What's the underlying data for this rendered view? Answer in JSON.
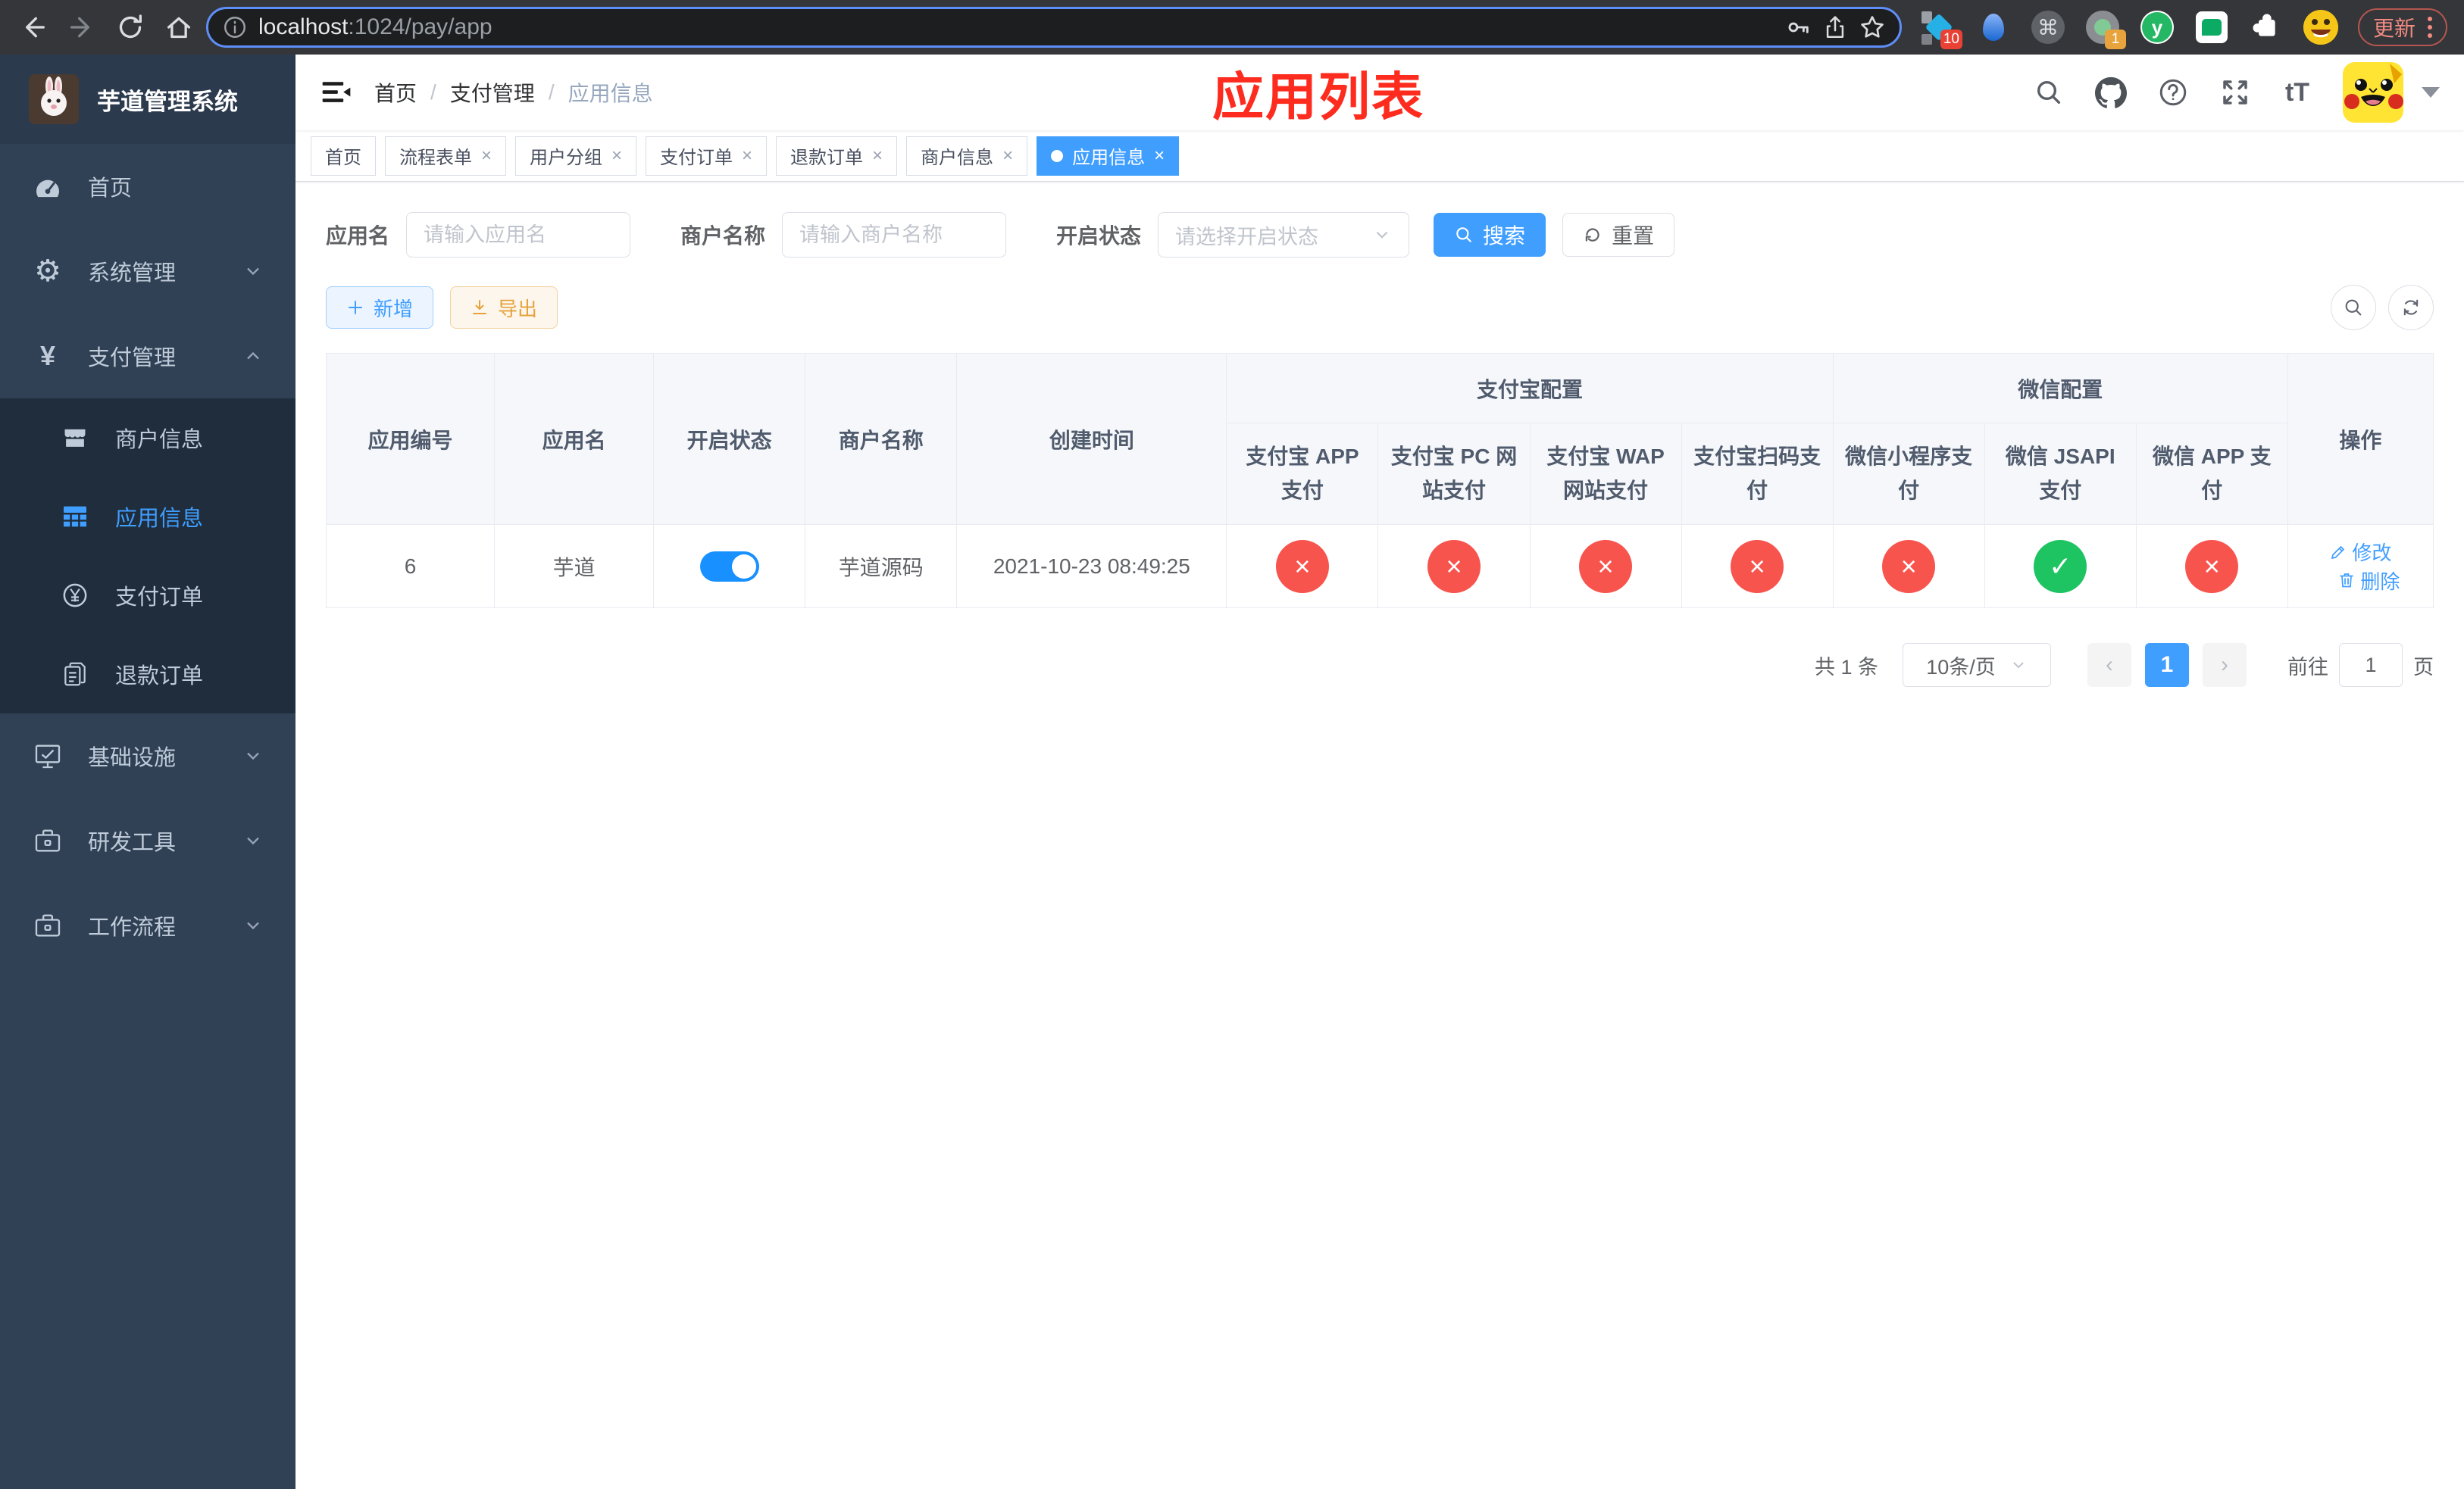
{
  "browser": {
    "url": {
      "host": "localhost",
      "path": ":1024/pay/app"
    },
    "update_label": "更新",
    "badges": {
      "diamond": "10",
      "profile": "1"
    },
    "yuque_letter": "y"
  },
  "sidebar": {
    "logo_title": "芋道管理系统",
    "home": "首页",
    "system": "系统管理",
    "payment": "支付管理",
    "sub_merchant": "商户信息",
    "sub_app": "应用信息",
    "sub_pay_order": "支付订单",
    "sub_refund_order": "退款订单",
    "infra": "基础设施",
    "dev_tools": "研发工具",
    "workflow": "工作流程",
    "payment_icon_glyph": "¥"
  },
  "breadcrumb": {
    "home": "首页",
    "sep": "/",
    "level2": "支付管理",
    "level3": "应用信息"
  },
  "annotation": {
    "title": "应用列表",
    "color": "#fd2c1e"
  },
  "navbar_icons": {
    "fontsize_glyph": "tT"
  },
  "tabs": {
    "close_glyph": "×",
    "items": [
      {
        "label": "首页",
        "closable": false,
        "active": false
      },
      {
        "label": "流程表单",
        "closable": true,
        "active": false
      },
      {
        "label": "用户分组",
        "closable": true,
        "active": false
      },
      {
        "label": "支付订单",
        "closable": true,
        "active": false
      },
      {
        "label": "退款订单",
        "closable": true,
        "active": false
      },
      {
        "label": "商户信息",
        "closable": true,
        "active": false
      },
      {
        "label": "应用信息",
        "closable": true,
        "active": true
      }
    ]
  },
  "filters": {
    "app_name_label": "应用名",
    "app_name_placeholder": "请输入应用名",
    "merchant_label": "商户名称",
    "merchant_placeholder": "请输入商户名称",
    "status_label": "开启状态",
    "status_placeholder": "请选择开启状态",
    "search_label": "搜索",
    "reset_label": "重置"
  },
  "toolbar": {
    "add_label": "新增",
    "export_label": "导出"
  },
  "table": {
    "headers": {
      "app_id": "应用编号",
      "app_name": "应用名",
      "status": "开启状态",
      "merchant": "商户名称",
      "created": "创建时间",
      "alipay_group": "支付宝配置",
      "wechat_group": "微信配置",
      "actions": "操作",
      "sub": [
        "支付宝 APP 支付",
        "支付宝 PC 网站支付",
        "支付宝 WAP 网站支付",
        "支付宝扫码支付",
        "微信小程序支付",
        "微信 JSAPI 支付",
        "微信 APP 支付"
      ]
    },
    "glyphs": {
      "yes": "✓",
      "no": "×"
    },
    "rows": [
      {
        "app_id": "6",
        "app_name": "芋道",
        "status_on": true,
        "merchant": "芋道源码",
        "created": "2021-10-23 08:49:25",
        "pay_channels": [
          false,
          false,
          false,
          false,
          false,
          true,
          false
        ],
        "edit_label": "修改",
        "delete_label": "删除"
      }
    ]
  },
  "pagination": {
    "total_text": "共 1 条",
    "page_size": "10条/页",
    "prev_glyph": "‹",
    "next_glyph": "›",
    "current_page": "1",
    "goto_label": "前往",
    "goto_value": "1",
    "page_unit": "页"
  },
  "colors": {
    "accent": "#409eff",
    "danger": "#f8544e",
    "success": "#1ec462",
    "switch_on": "#1890ff"
  }
}
